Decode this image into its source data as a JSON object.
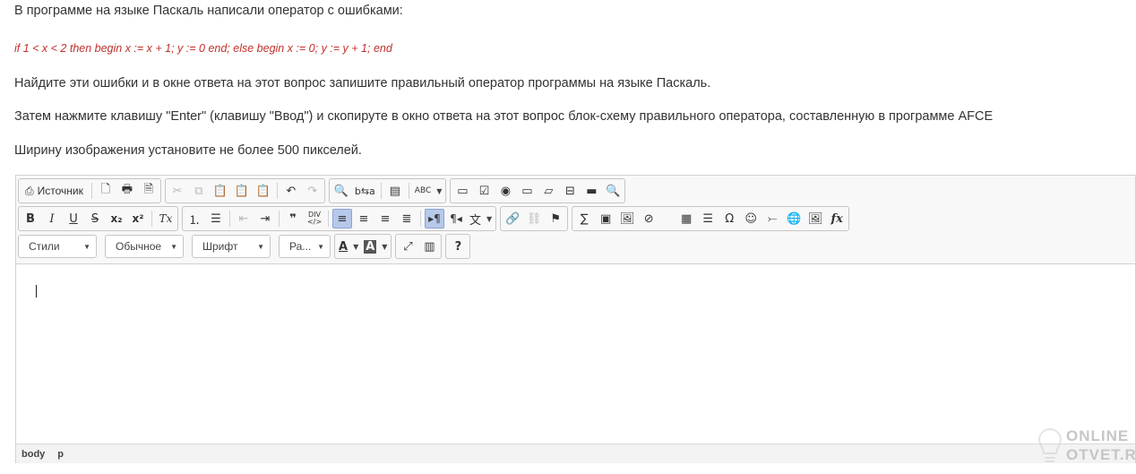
{
  "question": {
    "line1": "В программе на языке Паскаль написали оператор с ошибками:",
    "code": "if 1 < x < 2 then begin x := x + 1; y := 0 end; else begin x := 0; y := y + 1; end",
    "line2": "Найдите эти ошибки и в окне ответа на этот вопрос запишите правильный оператор программы на языке Паскаль.",
    "line3": "Затем нажмите клавишу \"Enter\" (клавишу \"Ввод\") и скопируте в окно ответа на этот вопрос блок-схему правильного оператора, составленную в программе AFCE",
    "line4": "Ширину изображения установите не более 500 пикселей."
  },
  "toolbar": {
    "source_label": "Источник",
    "styles_label": "Стили",
    "format_label": "Обычное",
    "font_label": "Шрифт",
    "size_label": "Ра...",
    "bold": "B",
    "italic": "I",
    "underline": "U",
    "strike": "S",
    "subscript": "x₂",
    "superscript": "x²",
    "removeformat": "Tx",
    "help": "?",
    "special_char": "Ω",
    "formula": "fx",
    "sigma": "∑",
    "spellcheck": "ABC"
  },
  "pathbar": {
    "items": [
      "body",
      "p"
    ]
  },
  "watermark": {
    "line1": "ONLINE",
    "line2": "OTVET.RU"
  },
  "colors": {
    "code_text": "#c0302c",
    "active_button": "#b6c9ea"
  }
}
